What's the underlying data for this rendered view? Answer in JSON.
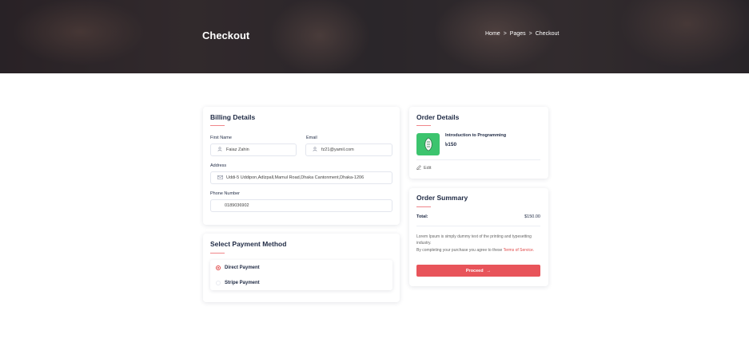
{
  "hero": {
    "title": "Checkout",
    "breadcrumb": [
      "Home",
      "Pages",
      "Checkout"
    ],
    "separator": ">"
  },
  "billing": {
    "title": "Billing Details",
    "first_name": {
      "label": "First Name",
      "value": "Faiaz Zahin",
      "icon": "user-icon"
    },
    "email": {
      "label": "Email",
      "value": "fz21@yamil.com",
      "icon": "user-icon"
    },
    "address": {
      "label": "Address",
      "value": "Uddi-5 Uddipon,Adlzpall,Mamul Road,Dhaka Cantonment,Dhaka-1206",
      "icon": "envelope-icon"
    },
    "phone": {
      "label": "Phone Number",
      "value": "0189036902"
    }
  },
  "payment": {
    "title": "Select Payment Method",
    "options": [
      {
        "label": "Direct Payment",
        "selected": true
      },
      {
        "label": "Stripe Payment",
        "selected": false
      }
    ]
  },
  "order_details": {
    "title": "Order Details",
    "course_title": "Introduction to Programming",
    "course_price": "৳150",
    "edit_label": "Edit"
  },
  "order_summary": {
    "title": "Order Summary",
    "total_label": "Total:",
    "total_value": "$150.00",
    "note_line1": "Lorem Ipsum is simply dummy text of the printing and typesetting industry.",
    "note_line2_prefix": "By completing your purchase you agree to these ",
    "terms_link": "Terms of Service.",
    "proceed_label": "Proceed",
    "proceed_arrow": "→"
  },
  "colors": {
    "accent": "#e8545a",
    "heading": "#1f2a44",
    "thumb": "#3cc46e"
  }
}
